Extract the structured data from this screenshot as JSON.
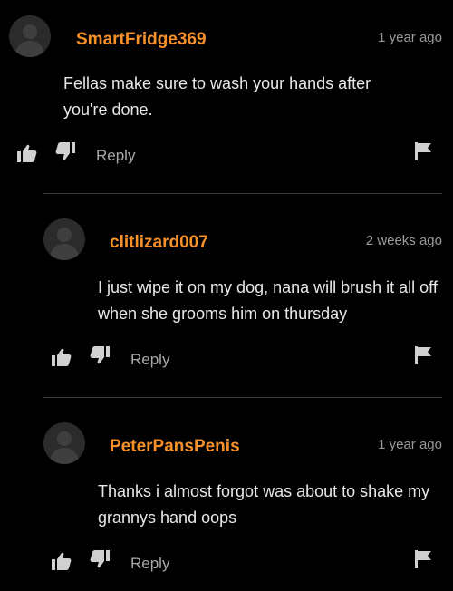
{
  "comments": [
    {
      "username": "SmartFridge369",
      "time": "1 year ago",
      "text": "Fellas make sure to wash your hands after you're done.",
      "reply_label": "Reply"
    },
    {
      "username": "clitlizard007",
      "time": "2 weeks ago",
      "text": "I just wipe it on my dog, nana will brush it all off when she grooms him on thursday",
      "reply_label": "Reply"
    },
    {
      "username": "PeterPansPenis",
      "time": "1 year ago",
      "text": "Thanks i almost forgot was about to shake my grannys hand oops",
      "reply_label": "Reply"
    }
  ],
  "colors": {
    "background": "#000000",
    "username": "#f6902a",
    "text": "#e8e8e8",
    "muted": "#9a9a9a"
  },
  "icons": [
    "avatar-silhouette",
    "thumbs-up-icon",
    "thumbs-down-icon",
    "flag-icon"
  ]
}
